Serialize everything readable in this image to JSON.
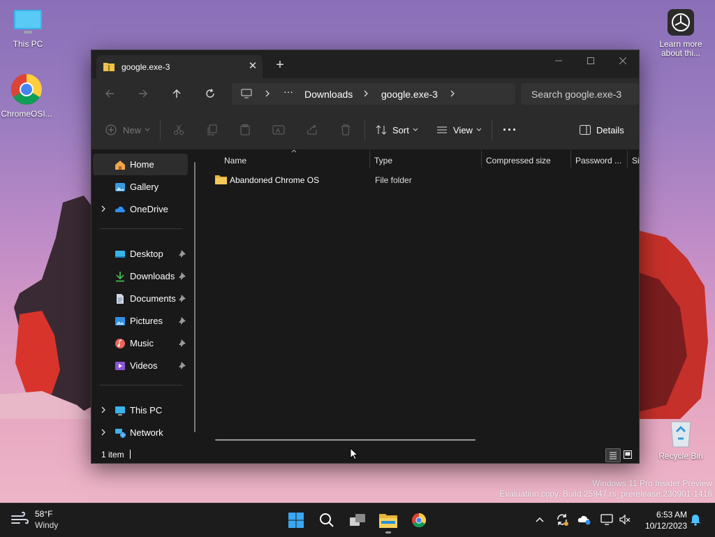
{
  "desktop": {
    "icons": [
      {
        "label": "This PC"
      },
      {
        "label": "ChromeOSI..."
      },
      {
        "label": "Learn more about thi..."
      },
      {
        "label": "Recycle Bin"
      }
    ],
    "watermark": {
      "line1": "Windows 11 Pro Insider Preview",
      "line2": "Evaluation copy. Build 25947.rs_prerelease.230901-1416"
    }
  },
  "window": {
    "tab_title": "google.exe-3",
    "breadcrumb": [
      "Downloads",
      "google.exe-3"
    ],
    "search_placeholder": "Search google.exe-3",
    "commands": {
      "new": "New",
      "sort": "Sort",
      "view": "View",
      "details": "Details"
    },
    "nav": [
      {
        "label": "Home",
        "icon": "home-icon",
        "selected": true
      },
      {
        "label": "Gallery",
        "icon": "gallery-icon"
      },
      {
        "label": "OneDrive",
        "icon": "onedrive-icon"
      },
      {
        "label": "Desktop",
        "icon": "desktop-icon",
        "pinned": true
      },
      {
        "label": "Downloads",
        "icon": "download-icon",
        "pinned": true
      },
      {
        "label": "Documents",
        "icon": "document-icon",
        "pinned": true
      },
      {
        "label": "Pictures",
        "icon": "picture-icon",
        "pinned": true
      },
      {
        "label": "Music",
        "icon": "music-icon",
        "pinned": true
      },
      {
        "label": "Videos",
        "icon": "video-icon",
        "pinned": true
      },
      {
        "label": "This PC",
        "icon": "this-pc-icon"
      },
      {
        "label": "Network",
        "icon": "network-icon"
      }
    ],
    "columns": [
      "Name",
      "Type",
      "Compressed size",
      "Password ...",
      "Si"
    ],
    "rows": [
      {
        "name": "Abandoned Chrome OS",
        "type": "File folder"
      }
    ],
    "status": {
      "item_count": "1 item"
    }
  },
  "taskbar": {
    "weather": {
      "temp": "58°F",
      "condition": "Windy"
    },
    "clock": {
      "time": "6:53 AM",
      "date": "10/12/2023"
    }
  },
  "colors": {
    "accent": "#4cc2ff",
    "folder": "#f0c24b",
    "window_bg": "#191919",
    "chrome_bg": "#2b2b2b"
  }
}
